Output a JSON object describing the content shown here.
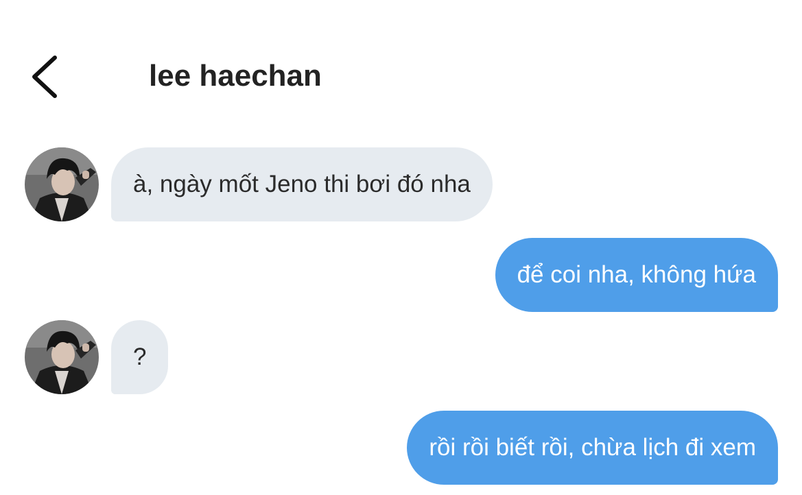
{
  "header": {
    "back_icon": "chevron-left-icon",
    "title": "lee haechan"
  },
  "messages": [
    {
      "direction": "incoming",
      "text": "à, ngày mốt Jeno thi bơi đó nha"
    },
    {
      "direction": "outgoing",
      "text": "để coi nha, không hứa"
    },
    {
      "direction": "incoming",
      "text": "?"
    },
    {
      "direction": "outgoing",
      "text": "rồi rồi biết rồi, chừa lịch đi xem"
    }
  ],
  "colors": {
    "incoming_bubble": "#e6ebf0",
    "outgoing_bubble": "#4f9ee9",
    "incoming_text": "#2b2b2b",
    "outgoing_text": "#ffffff",
    "title_text": "#232323"
  }
}
